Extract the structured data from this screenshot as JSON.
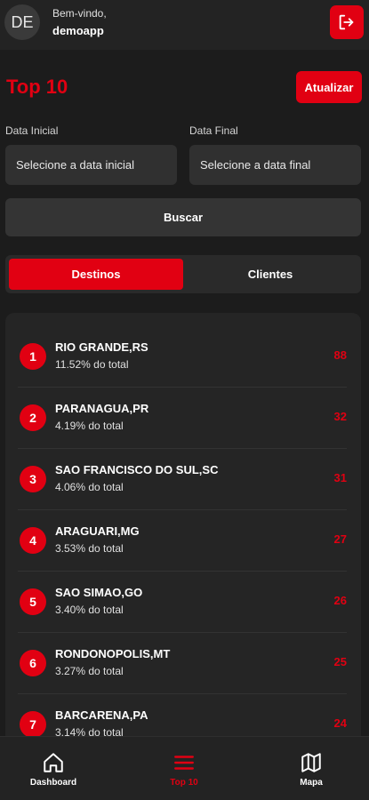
{
  "header": {
    "avatar_initials": "DE",
    "welcome": "Bem-vindo,",
    "username": "demoapp",
    "logout_icon": "logout-icon"
  },
  "page": {
    "title": "Top 10",
    "refresh_label": "Atualizar"
  },
  "filters": {
    "start_label": "Data Inicial",
    "start_placeholder": "Selecione a data inicial",
    "end_label": "Data Final",
    "end_placeholder": "Selecione a data final",
    "search_label": "Buscar"
  },
  "tabs": [
    {
      "label": "Destinos",
      "active": true
    },
    {
      "label": "Clientes",
      "active": false
    }
  ],
  "ranking": [
    {
      "rank": "1",
      "name": "RIO GRANDE,RS",
      "pct": "11.52% do total",
      "count": "88"
    },
    {
      "rank": "2",
      "name": "PARANAGUA,PR",
      "pct": "4.19% do total",
      "count": "32"
    },
    {
      "rank": "3",
      "name": "SAO FRANCISCO DO SUL,SC",
      "pct": "4.06% do total",
      "count": "31"
    },
    {
      "rank": "4",
      "name": "ARAGUARI,MG",
      "pct": "3.53% do total",
      "count": "27"
    },
    {
      "rank": "5",
      "name": "SAO SIMAO,GO",
      "pct": "3.40% do total",
      "count": "26"
    },
    {
      "rank": "6",
      "name": "RONDONOPOLIS,MT",
      "pct": "3.27% do total",
      "count": "25"
    },
    {
      "rank": "7",
      "name": "BARCARENA,PA",
      "pct": "3.14% do total",
      "count": "24"
    }
  ],
  "nav": [
    {
      "label": "Dashboard",
      "icon": "home-icon",
      "active": false
    },
    {
      "label": "Top 10",
      "icon": "list-icon",
      "active": true
    },
    {
      "label": "Mapa",
      "icon": "map-icon",
      "active": false
    }
  ],
  "colors": {
    "accent": "#e10012",
    "background": "#1c1c1c",
    "surface": "#252525"
  }
}
